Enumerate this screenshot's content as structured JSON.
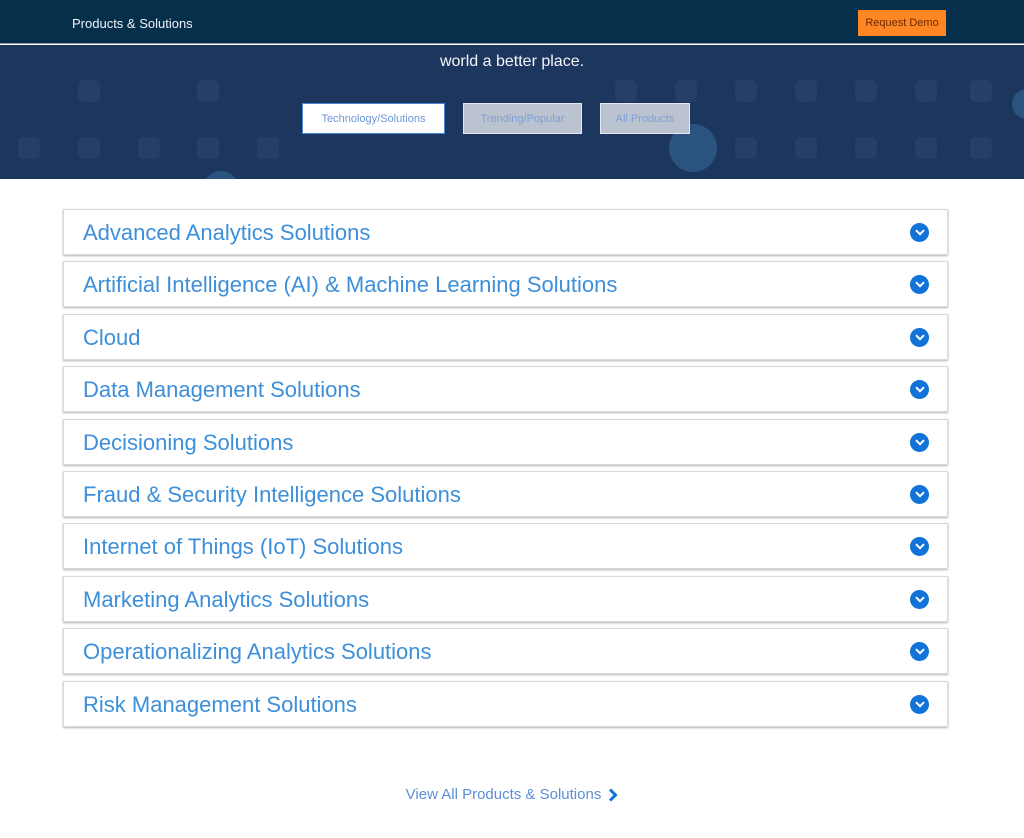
{
  "topbar": {
    "title": "Products & Solutions",
    "request_demo_label": "Request Demo"
  },
  "hero": {
    "tagline": "world a better place.",
    "filters": [
      {
        "label": "Technology/Solutions",
        "active": true
      },
      {
        "label": "Trending/Popular",
        "active": false
      },
      {
        "label": "All Products",
        "active": false
      }
    ]
  },
  "accordion": {
    "items": [
      {
        "label": "Advanced Analytics Solutions",
        "icon": "chevron-down-circle-icon"
      },
      {
        "label": "Artificial Intelligence (AI) & Machine Learning Solutions",
        "icon": "chevron-down-circle-icon"
      },
      {
        "label": "Cloud",
        "icon": "chevron-down-circle-icon"
      },
      {
        "label": "Data Management Solutions",
        "icon": "chevron-down-circle-icon"
      },
      {
        "label": "Decisioning Solutions",
        "icon": "chevron-down-circle-icon"
      },
      {
        "label": "Fraud & Security Intelligence Solutions",
        "icon": "chevron-down-circle-icon"
      },
      {
        "label": "Internet of Things (IoT) Solutions",
        "icon": "chevron-down-circle-icon"
      },
      {
        "label": "Marketing Analytics Solutions",
        "icon": "chevron-down-circle-icon"
      },
      {
        "label": "Operationalizing Analytics Solutions",
        "icon": "chevron-down-circle-icon"
      },
      {
        "label": "Risk Management Solutions",
        "icon": "chevron-down-circle-icon"
      }
    ]
  },
  "footer": {
    "view_all_label": "View All Products & Solutions",
    "view_all_icon": "chevron-right-icon"
  },
  "colors": {
    "nav_bg": "#062f4c",
    "hero_bg": "#1d365d",
    "accent_orange": "#ff8623",
    "link_blue": "#3d8fd9",
    "chevron_blue": "#1172d8"
  }
}
